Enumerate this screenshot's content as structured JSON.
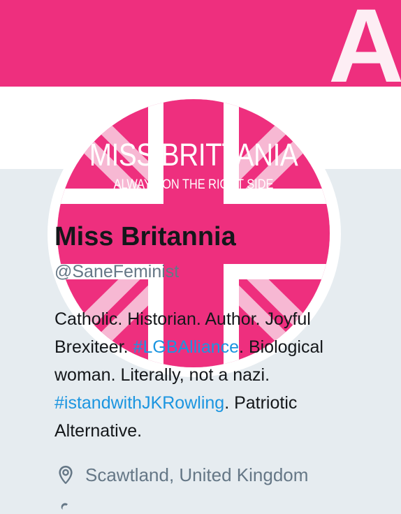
{
  "banner": {
    "visible_letters": "AL",
    "color": "#ee2f7e"
  },
  "avatar": {
    "title": "MISS BRITTANIA",
    "subtitle": "ALWAYS ON THE RIGHT SIDE",
    "colors": {
      "pink": "#ee2f7e",
      "light_pink": "#f7b8d3"
    }
  },
  "profile": {
    "display_name": "Miss Britannia",
    "handle": "@SaneFeminist",
    "bio": {
      "t1": "Catholic. Historian. Author. Joyful Brexiteer. ",
      "tag1": "#LGBAlliance",
      "t2": ". Biological woman. Literally, not a nazi. ",
      "tag2": "#istandwithJKRowling",
      "t3": ". Patriotic Alternative."
    },
    "location": "Scawtland, United Kingdom",
    "icons": {
      "location": "location-pin-icon",
      "next": "link-icon"
    }
  },
  "colors": {
    "text_primary": "#14171a",
    "text_secondary": "#657786",
    "link": "#1b95e0",
    "background": "#e6ecf0"
  }
}
